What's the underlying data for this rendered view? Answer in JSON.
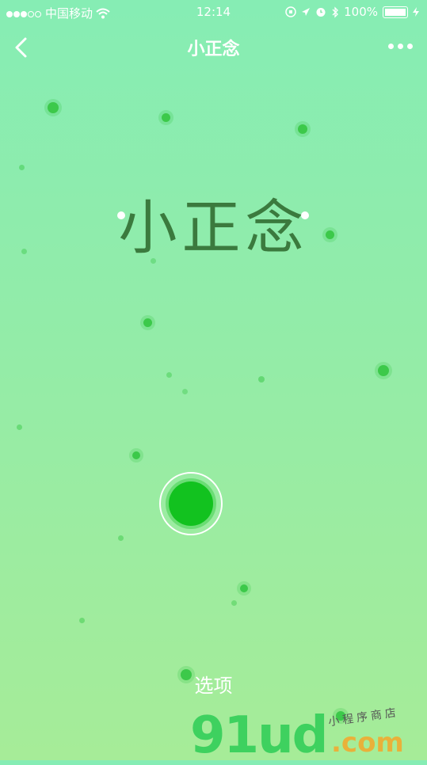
{
  "status_bar": {
    "carrier": "中国移动",
    "time": "12:14",
    "battery_percent": "100%"
  },
  "nav": {
    "title": "小正念"
  },
  "hero": {
    "title": "小正念"
  },
  "actions": {
    "options_label": "选项"
  },
  "watermark": {
    "logo_text": "91ud",
    "domain_text": ".com",
    "tagline": "小程序商店"
  },
  "colors": {
    "background_top": "#86edb4",
    "background_bottom": "#a6ec98",
    "hero_text": "#3b7a3e",
    "accent_green": "#12c21f"
  }
}
